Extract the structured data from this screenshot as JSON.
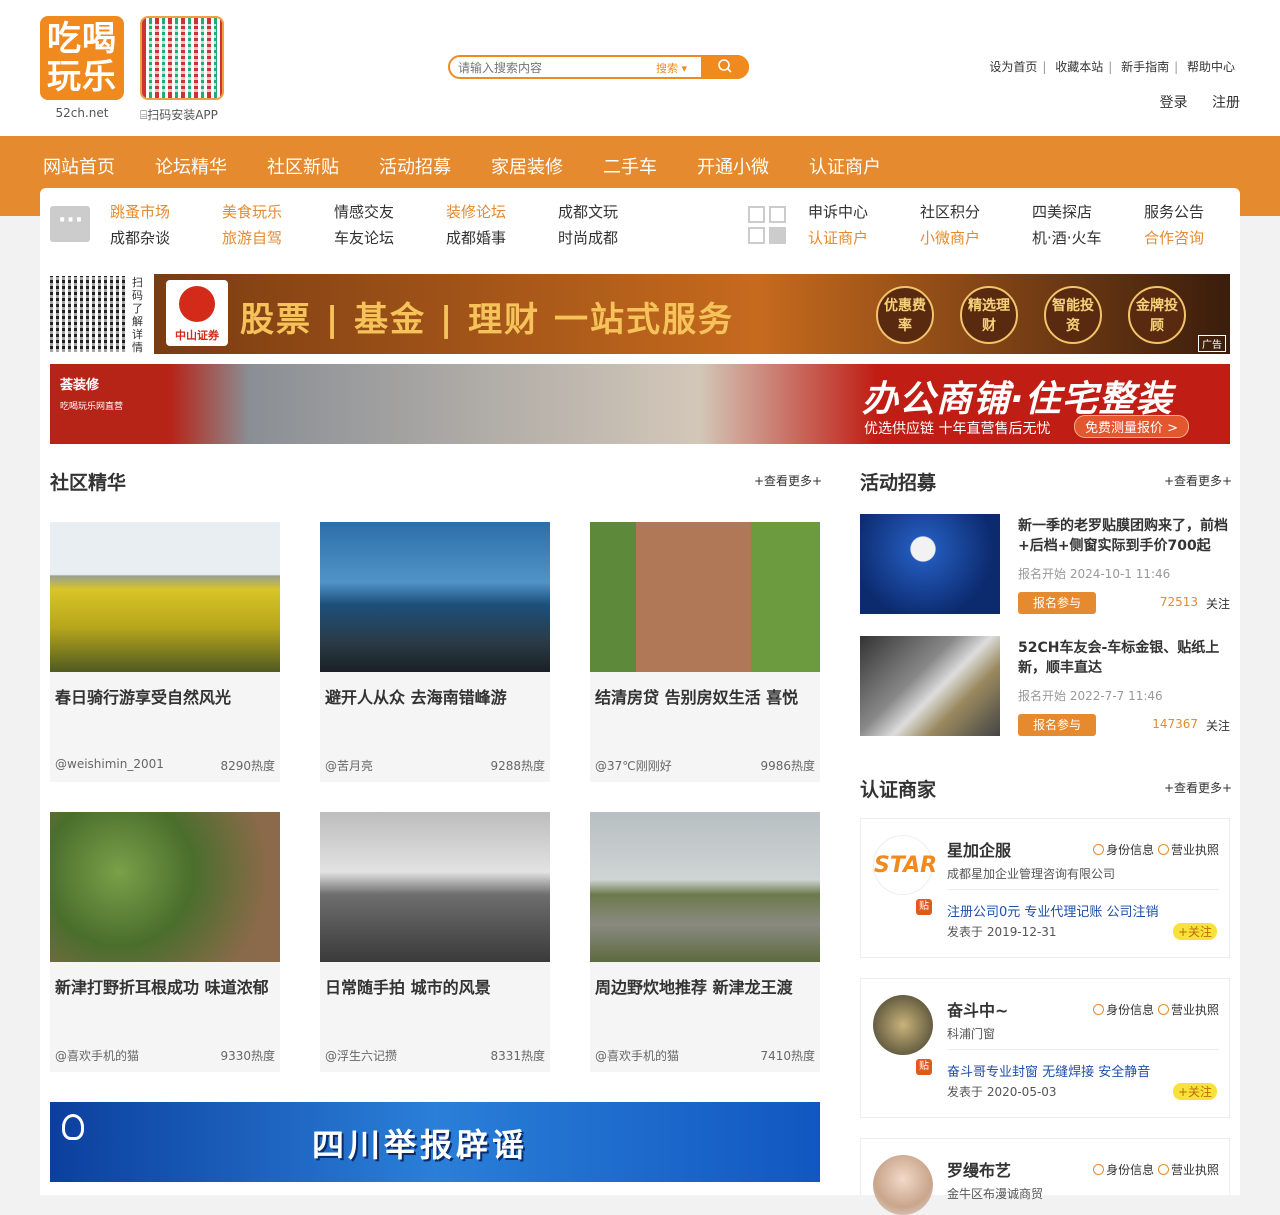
{
  "header": {
    "logo_text": "吃喝玩乐",
    "logo_domain": "52ch.net",
    "qr_label": "⌸扫码安装APP",
    "search": {
      "placeholder": "请输入搜索内容",
      "type_label": "搜索 ▾",
      "button_icon": "search-icon"
    },
    "top_links": [
      "设为首页",
      "收藏本站",
      "新手指南",
      "帮助中心"
    ],
    "login": "登录",
    "register": "注册"
  },
  "nav": [
    "网站首页",
    "论坛精华",
    "社区新贴",
    "活动招募",
    "家居装修",
    "二手车",
    "开通小微",
    "认证商户"
  ],
  "subnav": {
    "left": [
      {
        "top": "跳蚤市场",
        "bottom": "成都杂谈",
        "top_orange": true,
        "bottom_orange": false
      },
      {
        "top": "美食玩乐",
        "bottom": "旅游自驾",
        "top_orange": true,
        "bottom_orange": true
      },
      {
        "top": "情感交友",
        "bottom": "车友论坛",
        "top_orange": false,
        "bottom_orange": false
      },
      {
        "top": "装修论坛",
        "bottom": "成都婚事",
        "top_orange": true,
        "bottom_orange": false
      },
      {
        "top": "成都文玩",
        "bottom": "时尚成都",
        "top_orange": false,
        "bottom_orange": false
      }
    ],
    "right": [
      {
        "top": "申诉中心",
        "bottom": "认证商户",
        "top_orange": false,
        "bottom_orange": true
      },
      {
        "top": "社区积分",
        "bottom": "小微商户",
        "top_orange": false,
        "bottom_orange": true
      },
      {
        "top": "四美探店",
        "bottom": "机·酒·火车",
        "top_orange": false,
        "bottom_orange": false
      },
      {
        "top": "服务公告",
        "bottom": "合作咨询",
        "top_orange": false,
        "bottom_orange": true
      }
    ]
  },
  "ad1": {
    "side_text": "扫码了解详情",
    "brand": "中山证券",
    "headline": "股票 | 基金 | 理财  一站式服务",
    "pills": [
      "优惠费率",
      "精选理财",
      "智能投资",
      "金牌投顾"
    ],
    "ad_tag": "广告"
  },
  "ad2": {
    "brand": "荟装修",
    "brand_sub": "吃喝玩乐网直营",
    "headline": "办公商铺·住宅整装",
    "sub": "优选供应链  十年直营售后无忧",
    "cta": "免费测量报价 >"
  },
  "community": {
    "title": "社区精华",
    "more": "+查看更多+",
    "cards": [
      {
        "title": "春日骑行游享受自然风光",
        "user": "@weishimin_2001",
        "heat": "8290热度"
      },
      {
        "title": "避开人从众 去海南错峰游",
        "user": "@苦月亮",
        "heat": "9288热度"
      },
      {
        "title": "结清房贷 告别房奴生活 喜悦",
        "user": "@37℃刚刚好",
        "heat": "9986热度"
      },
      {
        "title": "新津打野折耳根成功 味道浓郁",
        "user": "@喜欢手机的猫",
        "heat": "9330热度"
      },
      {
        "title": "日常随手拍 城市的风景",
        "user": "@浮生六记攒",
        "heat": "8331热度"
      },
      {
        "title": "周边野炊地推荐 新津龙王渡",
        "user": "@喜欢手机的猫",
        "heat": "7410热度"
      }
    ]
  },
  "activities": {
    "title": "活动招募",
    "more": "+查看更多+",
    "items": [
      {
        "title": "新一季的老罗贴膜团购来了，前档+后档+侧窗实际到手价700起",
        "date": "报名开始 2024-10-1 11:46",
        "join": "报名参与",
        "count": "72513",
        "follow": "关注"
      },
      {
        "title": "52CH车友会-车标金银、贴纸上新，顺丰直达",
        "date": "报名开始 2022-7-7 11:46",
        "join": "报名参与",
        "count": "147367",
        "follow": "关注"
      }
    ]
  },
  "merchants": {
    "title": "认证商家",
    "more": "+查看更多+",
    "items": [
      {
        "name": "星加企服",
        "company": "成都星加企业管理咨询有限公司",
        "post": "注册公司0元 专业代理记账 公司注销",
        "date": "发表于 2019-12-31",
        "badge1": "身份信息",
        "badge2": "营业执照",
        "follow": "+关注",
        "tie": "贴"
      },
      {
        "name": "奋斗中~",
        "company": "科浦门窗",
        "post": "奋斗哥专业封窗 无缝焊接 安全静音",
        "date": "发表于 2020-05-03",
        "badge1": "身份信息",
        "badge2": "营业执照",
        "follow": "+关注",
        "tie": "贴"
      },
      {
        "name": "罗缦布艺",
        "company": "金牛区布漫诚商贸",
        "post": "",
        "date": "",
        "badge1": "身份信息",
        "badge2": "营业执照",
        "follow": "",
        "tie": ""
      }
    ]
  },
  "ad3": {
    "headline": "四川举报辟谣"
  },
  "colors": {
    "accent": "#e58a2e",
    "highlight": "#f7da1f",
    "link_blue": "#1e4fa8"
  }
}
